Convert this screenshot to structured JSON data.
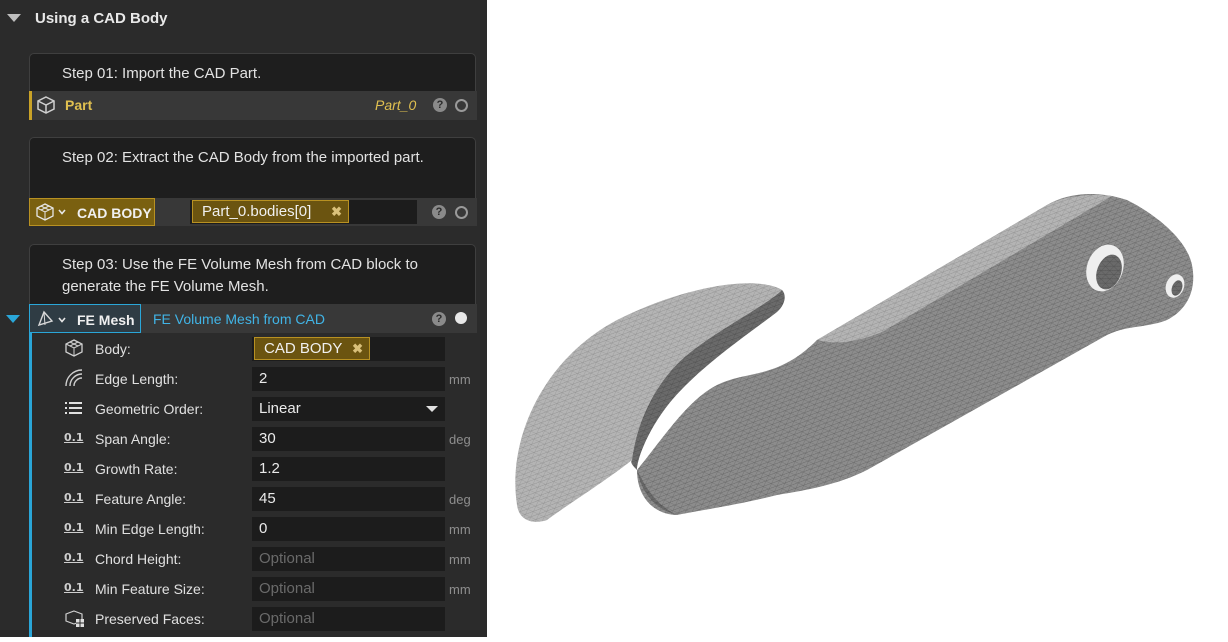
{
  "section": {
    "title": "Using a CAD Body"
  },
  "step1": {
    "note": "Step 01: Import the CAD Part.",
    "block_label": "Part",
    "block_value": "Part_0"
  },
  "step2": {
    "note": "Step 02: Extract the CAD Body from the imported part.",
    "block_label": "CAD BODY",
    "chip": "Part_0.bodies[0]"
  },
  "step3": {
    "note": "Step 03: Use the FE Volume Mesh from CAD block to generate the FE Volume Mesh.",
    "block_label": "FE Mesh",
    "block_title": "FE Volume Mesh from CAD"
  },
  "params": [
    {
      "label": "Body:",
      "value": "CAD BODY",
      "unit": ""
    },
    {
      "label": "Edge Length:",
      "value": "2",
      "unit": "mm"
    },
    {
      "label": "Geometric Order:",
      "value": "Linear",
      "unit": ""
    },
    {
      "label": "Span Angle:",
      "value": "30",
      "unit": "deg"
    },
    {
      "label": "Growth Rate:",
      "value": "1.2",
      "unit": ""
    },
    {
      "label": "Feature Angle:",
      "value": "45",
      "unit": "deg"
    },
    {
      "label": "Min Edge Length:",
      "value": "0",
      "unit": "mm"
    },
    {
      "label": "Chord Height:",
      "placeholder": "Optional",
      "unit": "mm"
    },
    {
      "label": "Min Feature Size:",
      "placeholder": "Optional",
      "unit": "mm"
    },
    {
      "label": "Preserved Faces:",
      "placeholder": "Optional",
      "unit": ""
    }
  ],
  "icons": {
    "help": "?",
    "remove": "✖",
    "numeric": "0.1"
  },
  "colors": {
    "panel_bg": "#2b2b2b",
    "accent_gold": "#c9a227",
    "accent_blue": "#2aa6d8",
    "part_value_gold": "#e0c050"
  }
}
